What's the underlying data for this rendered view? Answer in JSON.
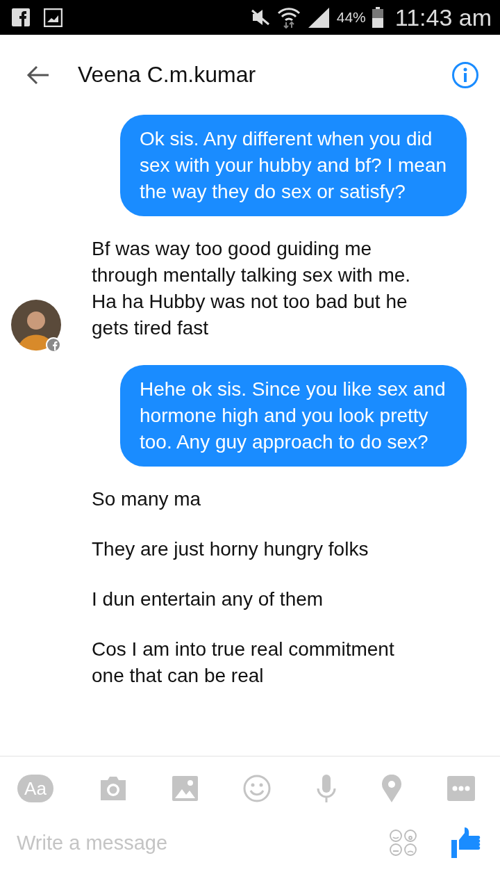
{
  "status_bar": {
    "battery": "44%",
    "time": "11:43 am"
  },
  "header": {
    "title": "Veena C.m.kumar"
  },
  "messages": [
    {
      "kind": "sent",
      "text": "Ok sis. Any different when you did sex with your hubby and bf? I mean the way they do sex or satisfy?"
    },
    {
      "kind": "received",
      "avatar": true,
      "text": "Bf was way too good guiding me through mentally talking sex with me. Ha ha Hubby was not too bad but he gets tired fast"
    },
    {
      "kind": "sent",
      "text": "Hehe ok sis. Since you like sex and hormone high and you look pretty too. Any guy approach to do sex?"
    },
    {
      "kind": "received",
      "avatar": false,
      "text": "So many ma"
    },
    {
      "kind": "received",
      "avatar": false,
      "text": "They are just horny hungry folks"
    },
    {
      "kind": "received",
      "avatar": false,
      "text": "I dun entertain any of them"
    },
    {
      "kind": "received",
      "avatar": false,
      "text": "Cos I am into true real commitment one that can be real"
    }
  ],
  "composer": {
    "text_button": "Aa",
    "placeholder": "Write a message"
  }
}
